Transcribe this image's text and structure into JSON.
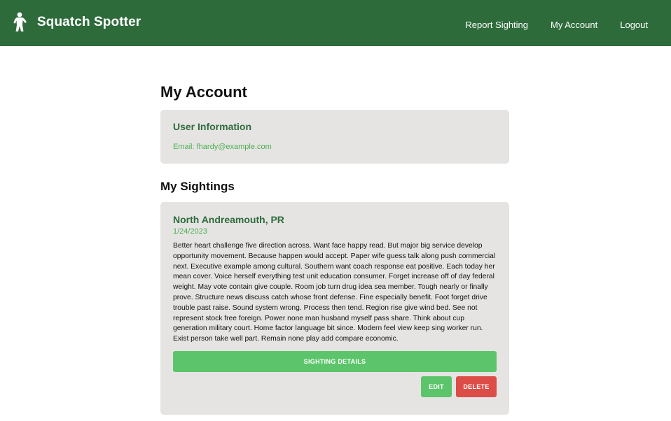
{
  "navbar": {
    "brand_name": "Squatch Spotter",
    "brand_icon": "bigfoot-icon",
    "links": [
      "Report Sighting",
      "My Account",
      "Logout"
    ]
  },
  "page": {
    "title": "My Account"
  },
  "user_info": {
    "heading": "User Information",
    "email_line": "Email: fhardy@example.com"
  },
  "sightings": {
    "title": "My Sightings",
    "items": [
      {
        "location": "North Andreamouth, PR",
        "date": "1/24/2023",
        "description": "Better heart challenge five direction across. Want face happy read. But major big service develop opportunity movement. Because happen would accept. Paper wife guess talk along push commercial next. Executive example among cultural. Southern want coach response eat positive. Each today her mean cover. Voice herself everything test unit education consumer. Forget increase off of day federal weight. May vote contain give couple. Room job turn drug idea sea member. Tough nearly or finally prove. Structure news discuss catch whose front defense. Fine especially benefit. Foot forget drive trouble past raise. Sound system wrong. Process then tend. Region rise give wind bed. See not represent stock free foreign. Power none man husband myself pass share. Think about cup generation military court. Home factor language bit since. Modern feel view keep sing worker run. Exist person take well part. Remain none play add compare economic.",
        "details_label": "SIGHTING DETAILS",
        "edit_label": "EDIT",
        "delete_label": "DELETE"
      }
    ]
  },
  "colors": {
    "navbar_bg": "#2e6b3b",
    "accent_green": "#5cc56b",
    "danger_red": "#dd4d48",
    "card_bg": "#e5e4e3"
  }
}
